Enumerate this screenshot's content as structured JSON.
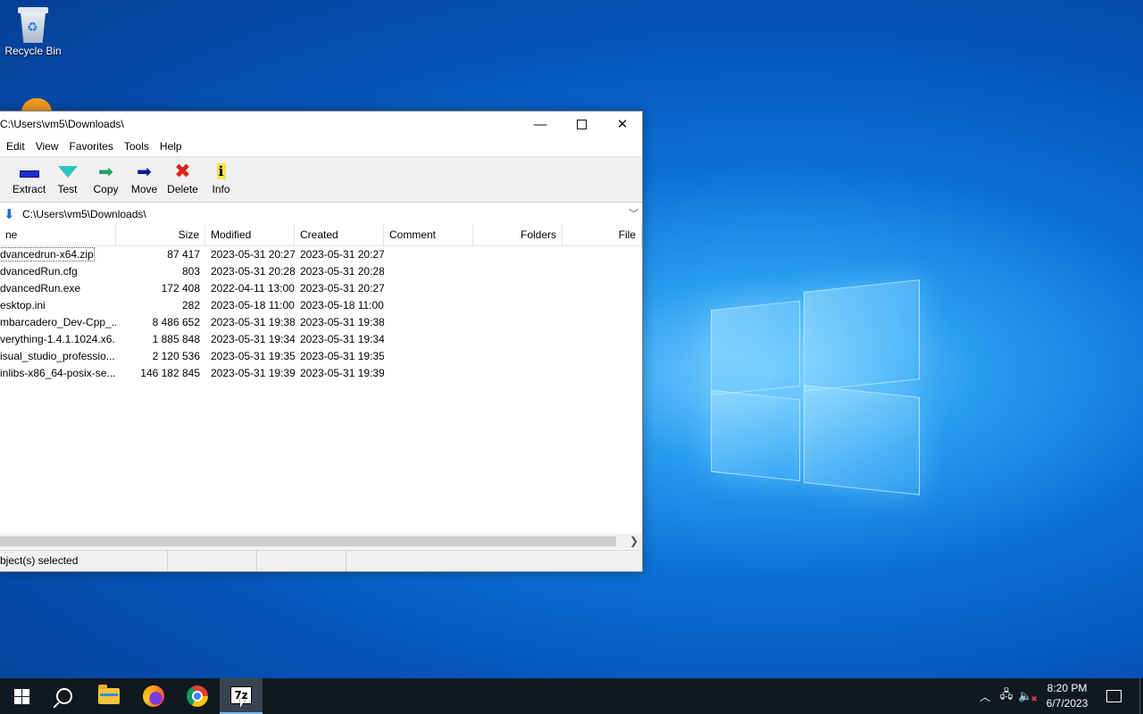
{
  "desktop": {
    "recycle_bin_label": "Recycle Bin"
  },
  "window": {
    "title": "C:\\Users\\vm5\\Downloads\\",
    "controls": {
      "minimize": "—",
      "maximize": "□",
      "close": "✕"
    },
    "menu": [
      "Edit",
      "View",
      "Favorites",
      "Tools",
      "Help"
    ],
    "toolbar": [
      {
        "name": "extract",
        "label": "Extract"
      },
      {
        "name": "test",
        "label": "Test"
      },
      {
        "name": "copy",
        "label": "Copy"
      },
      {
        "name": "move",
        "label": "Move"
      },
      {
        "name": "delete",
        "label": "Delete"
      },
      {
        "name": "info",
        "label": "Info"
      }
    ],
    "address": "C:\\Users\\vm5\\Downloads\\",
    "columns": [
      "ne",
      "Size",
      "Modified",
      "Created",
      "Comment",
      "Folders",
      "File"
    ],
    "rows": [
      {
        "name": "dvancedrun-x64.zip",
        "size": "87 417",
        "modified": "2023-05-31 20:27",
        "created": "2023-05-31 20:27",
        "selected": true
      },
      {
        "name": "dvancedRun.cfg",
        "size": "803",
        "modified": "2023-05-31 20:28",
        "created": "2023-05-31 20:28"
      },
      {
        "name": "dvancedRun.exe",
        "size": "172 408",
        "modified": "2022-04-11 13:00",
        "created": "2023-05-31 20:27"
      },
      {
        "name": "esktop.ini",
        "size": "282",
        "modified": "2023-05-18 11:00",
        "created": "2023-05-18 11:00"
      },
      {
        "name": "mbarcadero_Dev-Cpp_...",
        "size": "8 486 652",
        "modified": "2023-05-31 19:38",
        "created": "2023-05-31 19:38"
      },
      {
        "name": "verything-1.4.1.1024.x6...",
        "size": "1 885 848",
        "modified": "2023-05-31 19:34",
        "created": "2023-05-31 19:34"
      },
      {
        "name": "isual_studio_professio...",
        "size": "2 120 536",
        "modified": "2023-05-31 19:35",
        "created": "2023-05-31 19:35"
      },
      {
        "name": "inlibs-x86_64-posix-se...",
        "size": "146 182 845",
        "modified": "2023-05-31 19:39",
        "created": "2023-05-31 19:39"
      }
    ],
    "status": "bject(s) selected"
  },
  "taskbar": {
    "apps": [
      "start",
      "search",
      "file-explorer",
      "firefox",
      "chrome",
      "7-zip"
    ],
    "sz_label": "7z",
    "time": "8:20 PM",
    "date": "6/7/2023"
  }
}
